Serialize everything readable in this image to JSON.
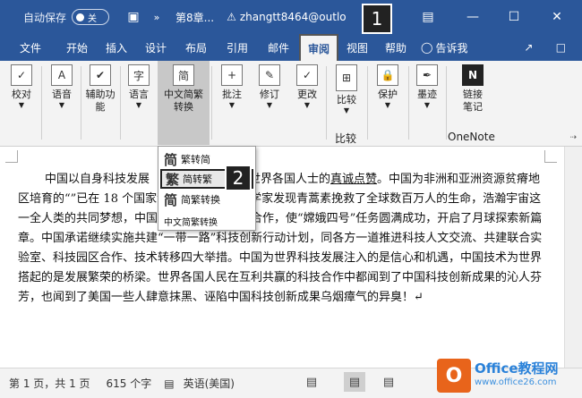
{
  "titlebar": {
    "autosave_label": "自动保存",
    "autosave_state": "关",
    "title": "第8章...",
    "user": "zhangtt8464@outlo",
    "user_suffix": "m"
  },
  "callouts": [
    "1",
    "2"
  ],
  "tabs": [
    {
      "label": "文件",
      "active": false
    },
    {
      "label": "开始",
      "active": false
    },
    {
      "label": "插入",
      "active": false
    },
    {
      "label": "设计",
      "active": false
    },
    {
      "label": "布局",
      "active": false
    },
    {
      "label": "引用",
      "active": false
    },
    {
      "label": "邮件",
      "active": false
    },
    {
      "label": "审阅",
      "active": true
    },
    {
      "label": "视图",
      "active": false
    },
    {
      "label": "帮助",
      "active": false
    }
  ],
  "tell_me": "告诉我",
  "ribbon": {
    "buttons": [
      {
        "l1": "校对",
        "l2": "",
        "icon": "abc-check-icon",
        "glyph": "✓"
      },
      {
        "l1": "语音",
        "l2": "",
        "icon": "speech-icon",
        "glyph": "A"
      },
      {
        "l1": "辅助功",
        "l2": "能",
        "icon": "accessibility-icon",
        "glyph": "✔"
      },
      {
        "l1": "语言",
        "l2": "",
        "icon": "language-icon",
        "glyph": "字"
      },
      {
        "l1": "中文简繁",
        "l2": "转换",
        "icon": "chinese-convert-icon",
        "glyph": "简"
      },
      {
        "l1": "批注",
        "l2": "",
        "icon": "comment-icon",
        "glyph": "+"
      },
      {
        "l1": "修订",
        "l2": "",
        "icon": "track-changes-icon",
        "glyph": "✎"
      },
      {
        "l1": "更改",
        "l2": "",
        "icon": "changes-icon",
        "glyph": "✓"
      },
      {
        "l1": "比较",
        "l2": "",
        "icon": "compare-icon",
        "glyph": "⊞"
      },
      {
        "l1": "保护",
        "l2": "",
        "icon": "protect-icon",
        "glyph": "🔒"
      },
      {
        "l1": "墨迹",
        "l2": "",
        "icon": "ink-icon",
        "glyph": "✒"
      },
      {
        "l1": "链接",
        "l2": "笔记",
        "icon": "onenote-icon",
        "glyph": "N"
      }
    ],
    "group_compare": "比较",
    "group_onenote": "OneNote"
  },
  "dropdown": [
    {
      "glyph": "简",
      "label": "繁转简",
      "selected": false
    },
    {
      "glyph": "繁",
      "label": "简转繁",
      "selected": true
    },
    {
      "glyph": "简",
      "label": "简繁转换",
      "selected": false
    }
  ],
  "dropdown_tooltip": "中文简繁转换",
  "document": {
    "p_start": "中国以自身科技发展",
    "p_mid1": "了来自世界各国人士的",
    "p_underline": "真诚点赞",
    "p_rest": "。中国为非洲和亚洲资源贫瘠地区培育的“",
    "p_hidden": "”已在 18 个国家试种推广，中国科学家发现青蒿素挽救了全球数百万人的生命，",
    "p_mid2": "浩瀚宇宙这一全人类的共同梦想，中国积极推动国际航天合作，使“嫦娥四号”任务圆满成功，开启了月球探索新篇章。中国承诺继续实施共建“一带一路”科技创新行动计划，同各方一道推进科技人文交流、共建联合实验室、科技园区合作、技术转移四大举措。中国为世界科技发展注入的是信心和机遇，中国技术为世界搭起的是发展繁荣的桥梁。世界各国人民在互利共赢的科技合作中都闻到了中国科技创新成果的沁人芬芳，也闻到了美国一些人肆意抹黑、诬陷中国科技创新成果乌烟瘴气的异臭！",
    "para_mark": "↵"
  },
  "status": {
    "page": "第 1 页，共 1 页",
    "words": "615 个字",
    "language": "英语(美国)"
  },
  "watermark": {
    "line1": "Office教程网",
    "line2": "www.office26.com"
  },
  "colors": {
    "accent": "#2b579a",
    "ribbon_bg": "#f3f3f3",
    "watermark_orange": "#e8641b",
    "watermark_blue": "#2b82d9"
  }
}
